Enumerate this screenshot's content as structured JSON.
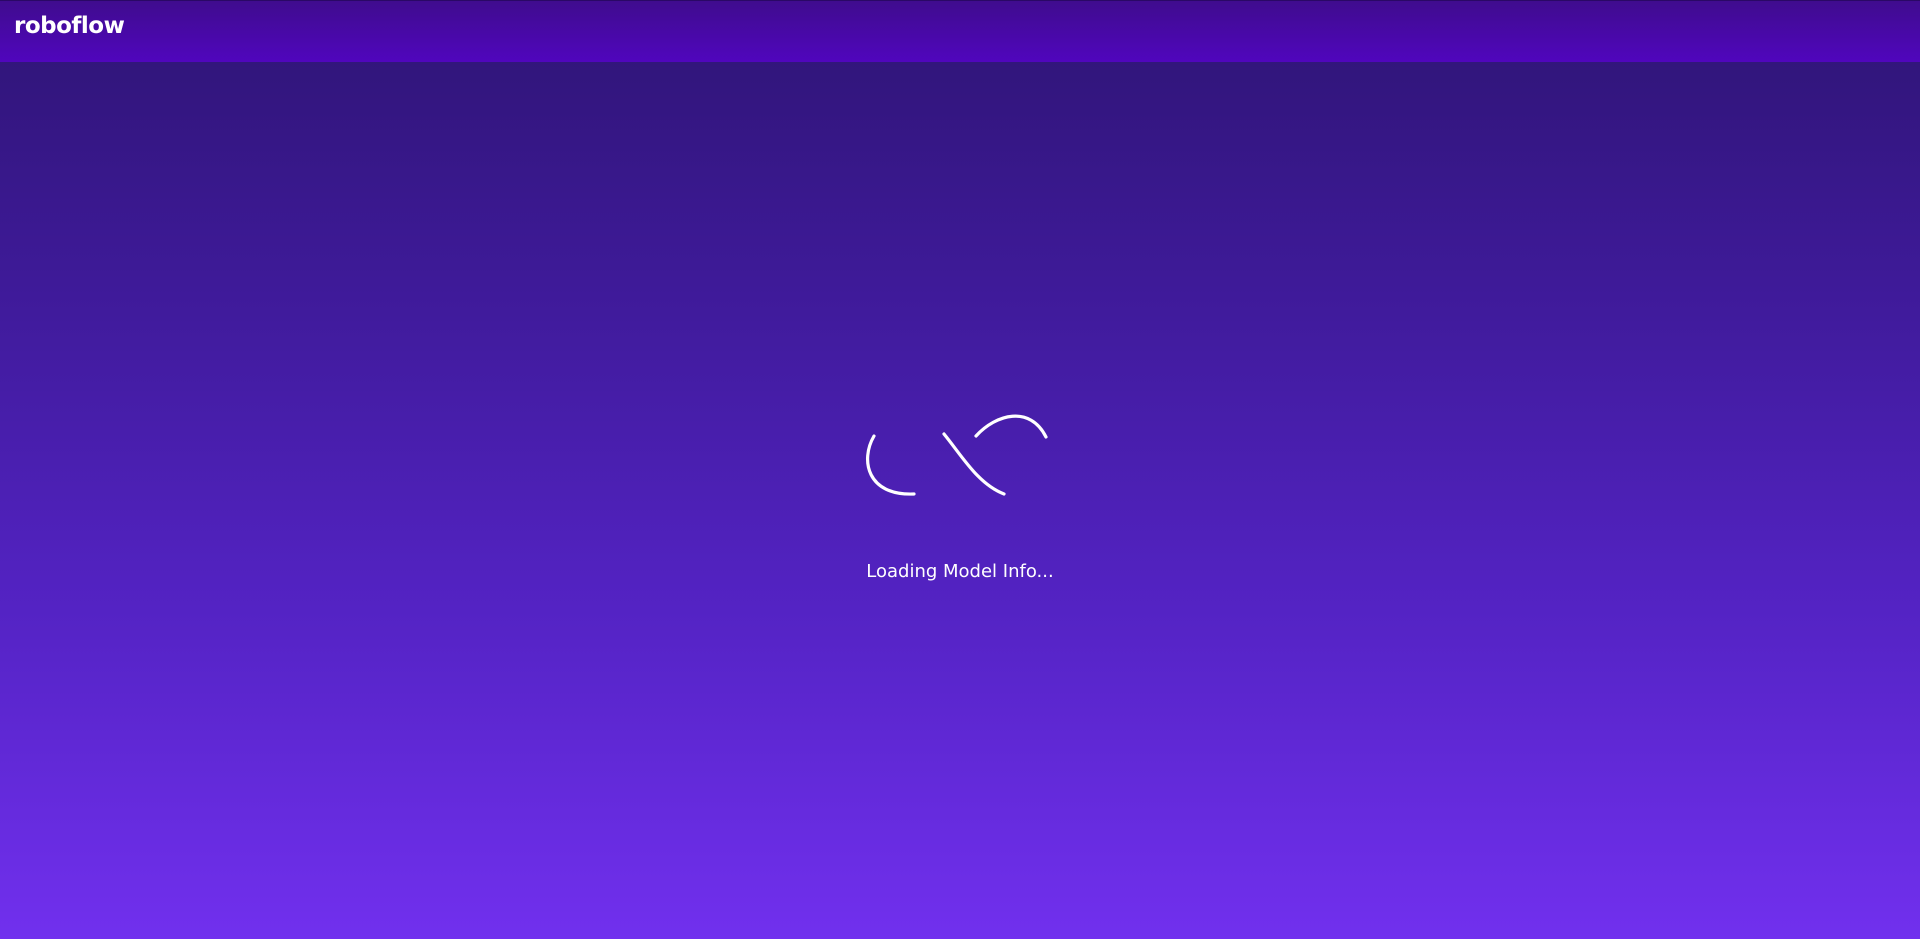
{
  "header": {
    "logo_text": "roboflow"
  },
  "main": {
    "spinner_icon": "loading-spinner-icon",
    "loading_message": "Loading Model Info..."
  },
  "colors": {
    "header_top": "#3f0c8e",
    "header_bottom": "#5006bd",
    "background_top": "#2e1474",
    "background_bottom": "#7130ee",
    "wave_lines": "#0f0a3a",
    "text": "#ffffff"
  }
}
